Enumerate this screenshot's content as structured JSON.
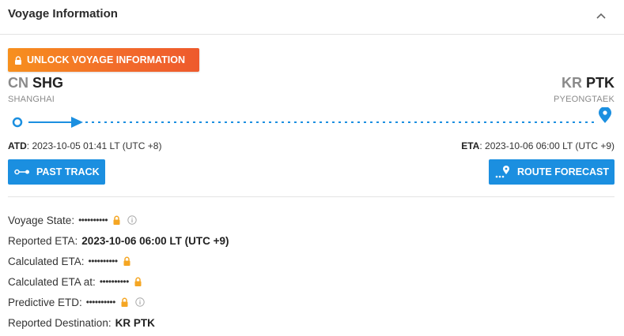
{
  "header": {
    "title": "Voyage Information",
    "collapse_icon": "chevron-up-icon"
  },
  "unlock": {
    "label": "UNLOCK VOYAGE INFORMATION",
    "icon": "lock-icon"
  },
  "departure": {
    "country": "CN",
    "port": "SHG",
    "name": "SHANGHAI"
  },
  "arrival": {
    "country": "KR",
    "port": "PTK",
    "name": "PYEONGTAEK"
  },
  "times": {
    "atd_label": "ATD",
    "atd_value": "2023-10-05 01:41 LT (UTC +8)",
    "eta_label": "ETA",
    "eta_value": "2023-10-06 06:00 LT (UTC +9)"
  },
  "buttons": {
    "past_track": "PAST TRACK",
    "route_forecast": "ROUTE FORECAST"
  },
  "details": [
    {
      "label": "Voyage State:",
      "value": "••••••••••",
      "locked": true,
      "info": true
    },
    {
      "label": "Reported ETA:",
      "value": "2023-10-06 06:00 LT (UTC +9)",
      "locked": false,
      "info": false
    },
    {
      "label": "Calculated ETA:",
      "value": "••••••••••",
      "locked": true,
      "info": false
    },
    {
      "label": "Calculated ETA at:",
      "value": "••••••••••",
      "locked": true,
      "info": false
    },
    {
      "label": "Predictive ETD:",
      "value": "••••••••••",
      "locked": true,
      "info": true
    },
    {
      "label": "Reported Destination:",
      "value": "KR PTK",
      "locked": false,
      "info": false
    }
  ],
  "colors": {
    "accent_blue": "#1b8fe0",
    "lock_orange": "#f5a623",
    "unlock_gradient_start": "#f7901e",
    "unlock_gradient_end": "#ee5a2c"
  }
}
